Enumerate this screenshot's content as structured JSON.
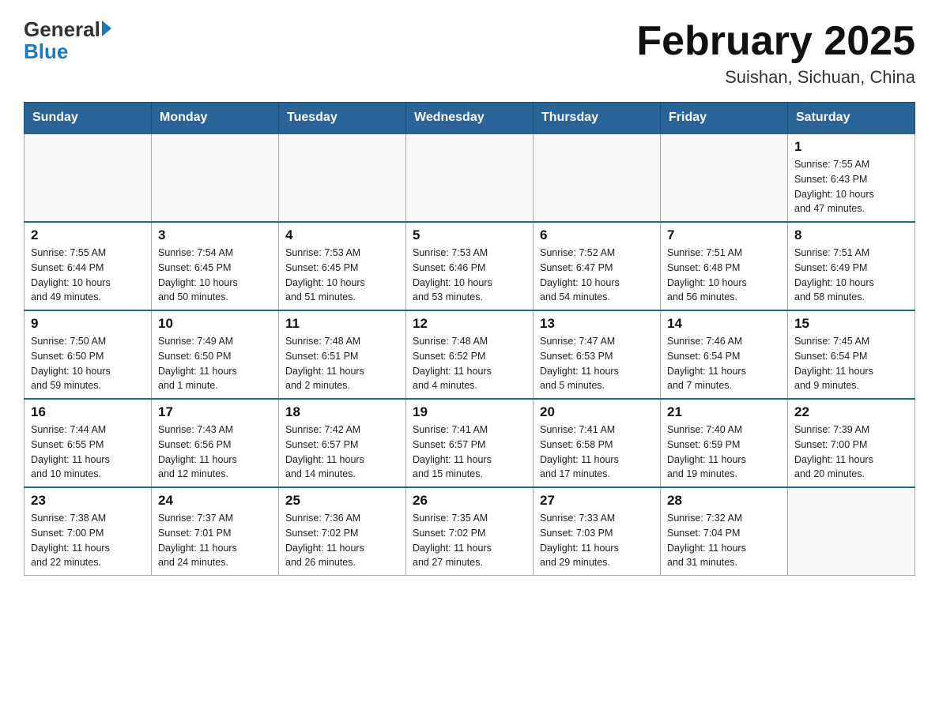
{
  "header": {
    "logo_general": "General",
    "logo_blue": "Blue",
    "main_title": "February 2025",
    "subtitle": "Suishan, Sichuan, China"
  },
  "days_of_week": [
    "Sunday",
    "Monday",
    "Tuesday",
    "Wednesday",
    "Thursday",
    "Friday",
    "Saturday"
  ],
  "weeks": [
    {
      "days": [
        {
          "num": "",
          "info": ""
        },
        {
          "num": "",
          "info": ""
        },
        {
          "num": "",
          "info": ""
        },
        {
          "num": "",
          "info": ""
        },
        {
          "num": "",
          "info": ""
        },
        {
          "num": "",
          "info": ""
        },
        {
          "num": "1",
          "info": "Sunrise: 7:55 AM\nSunset: 6:43 PM\nDaylight: 10 hours\nand 47 minutes."
        }
      ]
    },
    {
      "days": [
        {
          "num": "2",
          "info": "Sunrise: 7:55 AM\nSunset: 6:44 PM\nDaylight: 10 hours\nand 49 minutes."
        },
        {
          "num": "3",
          "info": "Sunrise: 7:54 AM\nSunset: 6:45 PM\nDaylight: 10 hours\nand 50 minutes."
        },
        {
          "num": "4",
          "info": "Sunrise: 7:53 AM\nSunset: 6:45 PM\nDaylight: 10 hours\nand 51 minutes."
        },
        {
          "num": "5",
          "info": "Sunrise: 7:53 AM\nSunset: 6:46 PM\nDaylight: 10 hours\nand 53 minutes."
        },
        {
          "num": "6",
          "info": "Sunrise: 7:52 AM\nSunset: 6:47 PM\nDaylight: 10 hours\nand 54 minutes."
        },
        {
          "num": "7",
          "info": "Sunrise: 7:51 AM\nSunset: 6:48 PM\nDaylight: 10 hours\nand 56 minutes."
        },
        {
          "num": "8",
          "info": "Sunrise: 7:51 AM\nSunset: 6:49 PM\nDaylight: 10 hours\nand 58 minutes."
        }
      ]
    },
    {
      "days": [
        {
          "num": "9",
          "info": "Sunrise: 7:50 AM\nSunset: 6:50 PM\nDaylight: 10 hours\nand 59 minutes."
        },
        {
          "num": "10",
          "info": "Sunrise: 7:49 AM\nSunset: 6:50 PM\nDaylight: 11 hours\nand 1 minute."
        },
        {
          "num": "11",
          "info": "Sunrise: 7:48 AM\nSunset: 6:51 PM\nDaylight: 11 hours\nand 2 minutes."
        },
        {
          "num": "12",
          "info": "Sunrise: 7:48 AM\nSunset: 6:52 PM\nDaylight: 11 hours\nand 4 minutes."
        },
        {
          "num": "13",
          "info": "Sunrise: 7:47 AM\nSunset: 6:53 PM\nDaylight: 11 hours\nand 5 minutes."
        },
        {
          "num": "14",
          "info": "Sunrise: 7:46 AM\nSunset: 6:54 PM\nDaylight: 11 hours\nand 7 minutes."
        },
        {
          "num": "15",
          "info": "Sunrise: 7:45 AM\nSunset: 6:54 PM\nDaylight: 11 hours\nand 9 minutes."
        }
      ]
    },
    {
      "days": [
        {
          "num": "16",
          "info": "Sunrise: 7:44 AM\nSunset: 6:55 PM\nDaylight: 11 hours\nand 10 minutes."
        },
        {
          "num": "17",
          "info": "Sunrise: 7:43 AM\nSunset: 6:56 PM\nDaylight: 11 hours\nand 12 minutes."
        },
        {
          "num": "18",
          "info": "Sunrise: 7:42 AM\nSunset: 6:57 PM\nDaylight: 11 hours\nand 14 minutes."
        },
        {
          "num": "19",
          "info": "Sunrise: 7:41 AM\nSunset: 6:57 PM\nDaylight: 11 hours\nand 15 minutes."
        },
        {
          "num": "20",
          "info": "Sunrise: 7:41 AM\nSunset: 6:58 PM\nDaylight: 11 hours\nand 17 minutes."
        },
        {
          "num": "21",
          "info": "Sunrise: 7:40 AM\nSunset: 6:59 PM\nDaylight: 11 hours\nand 19 minutes."
        },
        {
          "num": "22",
          "info": "Sunrise: 7:39 AM\nSunset: 7:00 PM\nDaylight: 11 hours\nand 20 minutes."
        }
      ]
    },
    {
      "days": [
        {
          "num": "23",
          "info": "Sunrise: 7:38 AM\nSunset: 7:00 PM\nDaylight: 11 hours\nand 22 minutes."
        },
        {
          "num": "24",
          "info": "Sunrise: 7:37 AM\nSunset: 7:01 PM\nDaylight: 11 hours\nand 24 minutes."
        },
        {
          "num": "25",
          "info": "Sunrise: 7:36 AM\nSunset: 7:02 PM\nDaylight: 11 hours\nand 26 minutes."
        },
        {
          "num": "26",
          "info": "Sunrise: 7:35 AM\nSunset: 7:02 PM\nDaylight: 11 hours\nand 27 minutes."
        },
        {
          "num": "27",
          "info": "Sunrise: 7:33 AM\nSunset: 7:03 PM\nDaylight: 11 hours\nand 29 minutes."
        },
        {
          "num": "28",
          "info": "Sunrise: 7:32 AM\nSunset: 7:04 PM\nDaylight: 11 hours\nand 31 minutes."
        },
        {
          "num": "",
          "info": ""
        }
      ]
    }
  ]
}
